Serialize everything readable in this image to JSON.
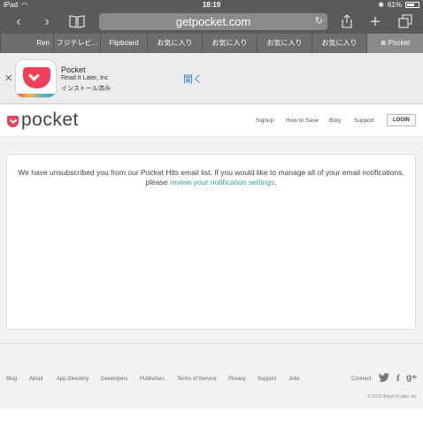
{
  "status_bar": {
    "device": "iPad",
    "time": "18:19",
    "battery": "61%"
  },
  "safari": {
    "url": "getpocket.com",
    "tabs": [
      "Ren",
      "フジテレビ...",
      "Flipboard",
      "お気に入り",
      "お気に入り",
      "お気に入り",
      "お気に入り",
      "Pocket"
    ]
  },
  "app_banner": {
    "name": "Pocket",
    "developer": "Read It Later, Inc",
    "status": "インストール済み",
    "open_label": "開く"
  },
  "header": {
    "logo": "pocket",
    "nav": [
      "Signup",
      "How to Save",
      "Blog",
      "Support"
    ],
    "login": "LOGIN"
  },
  "message": {
    "text": "We have unsubscribed you from our Pocket Hits email list. If you would like to manage all of your email notifications, please",
    "link": "review your notification settings",
    "end": "."
  },
  "footer": {
    "links": [
      "Blog",
      "About",
      "App Directory",
      "Developers",
      "Publishers",
      "Terms of Service",
      "Privacy",
      "Support",
      "Jobs"
    ],
    "connect": "Connect",
    "social": [
      "twitter-icon",
      "facebook-icon",
      "google-plus-icon"
    ],
    "copyright": "© 2015 Read It Later, Inc"
  }
}
